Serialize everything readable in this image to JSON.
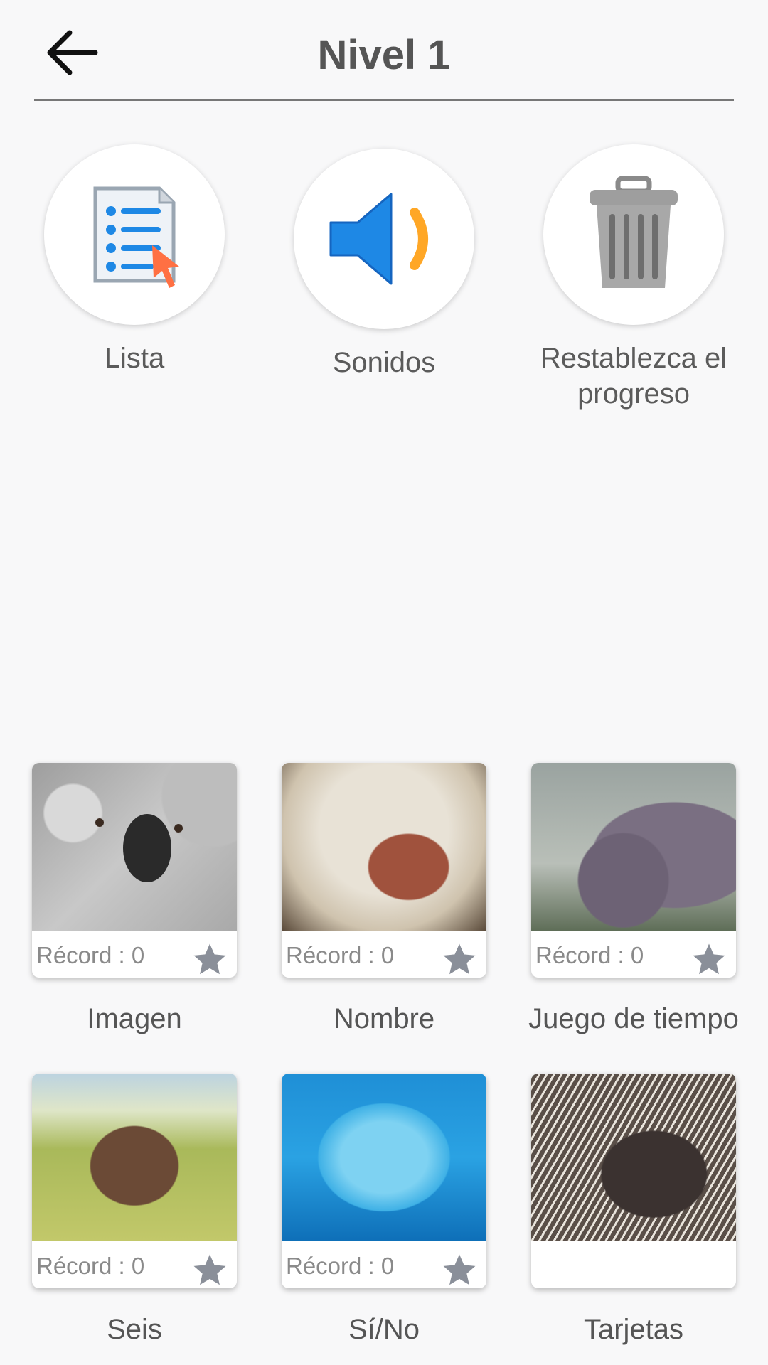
{
  "header": {
    "title": "Nivel 1",
    "back_icon": "arrow-left-icon"
  },
  "options": [
    {
      "key": "list",
      "label": "Lista",
      "icon": "list-document-icon"
    },
    {
      "key": "sounds",
      "label": "Sonidos",
      "icon": "speaker-icon"
    },
    {
      "key": "reset",
      "label": "Restablezca el progreso",
      "icon": "trash-icon"
    }
  ],
  "games": [
    {
      "label": "Imagen",
      "record": "Récord : 0",
      "image": "koala-photo"
    },
    {
      "label": "Nombre",
      "record": "Récord : 0",
      "image": "baboon-photo"
    },
    {
      "label": "Juego de tiempo",
      "record": "Récord : 0",
      "image": "hippo-photo"
    },
    {
      "label": "Seis",
      "record": "Récord : 0",
      "image": "elephant-photo"
    },
    {
      "label": "Sí/No",
      "record": "Récord : 0",
      "image": "dolphin-photo"
    },
    {
      "label": "Tarjetas",
      "record": "",
      "image": "porcupine-photo"
    }
  ],
  "colors": {
    "background": "#f8f8f9",
    "speaker_blue": "#1e88e5",
    "speaker_orange": "#ffa726",
    "text": "#555555"
  }
}
